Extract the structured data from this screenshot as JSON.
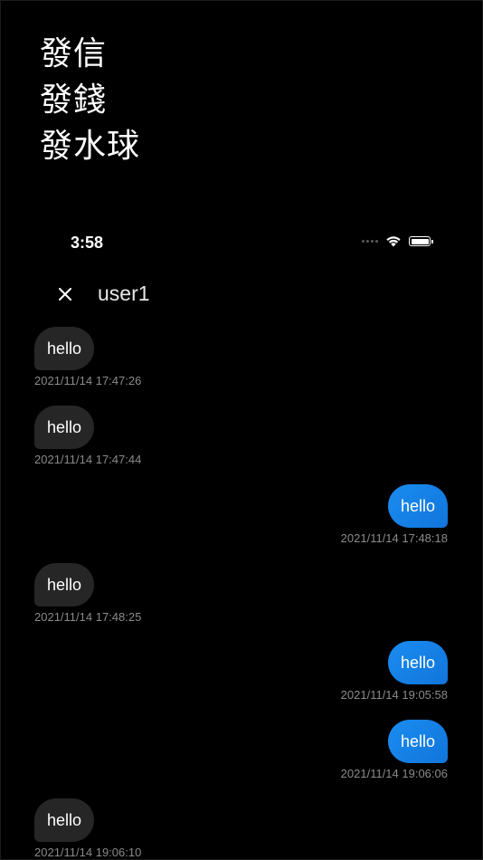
{
  "promo": {
    "lines": [
      "發信",
      "發錢",
      "發水球"
    ]
  },
  "status_bar": {
    "time": "3:58",
    "icons": [
      "signal-dots-icon",
      "wifi-icon",
      "battery-icon"
    ]
  },
  "chat": {
    "title": "user1",
    "close_icon": "close-icon",
    "messages": [
      {
        "direction": "in",
        "text": "hello",
        "timestamp": "2021/11/14 17:47:26"
      },
      {
        "direction": "in",
        "text": "hello",
        "timestamp": "2021/11/14 17:47:44"
      },
      {
        "direction": "out",
        "text": "hello",
        "timestamp": "2021/11/14 17:48:18"
      },
      {
        "direction": "in",
        "text": "hello",
        "timestamp": "2021/11/14 17:48:25"
      },
      {
        "direction": "out",
        "text": "hello",
        "timestamp": "2021/11/14 19:05:58"
      },
      {
        "direction": "out",
        "text": "hello",
        "timestamp": "2021/11/14 19:06:06"
      },
      {
        "direction": "in",
        "text": "hello",
        "timestamp": "2021/11/14 19:06:10"
      }
    ]
  },
  "colors": {
    "background": "#000000",
    "incoming_bubble": "#262626",
    "outgoing_bubble": "#1a8cf0",
    "timestamp": "#8a8a8a"
  }
}
